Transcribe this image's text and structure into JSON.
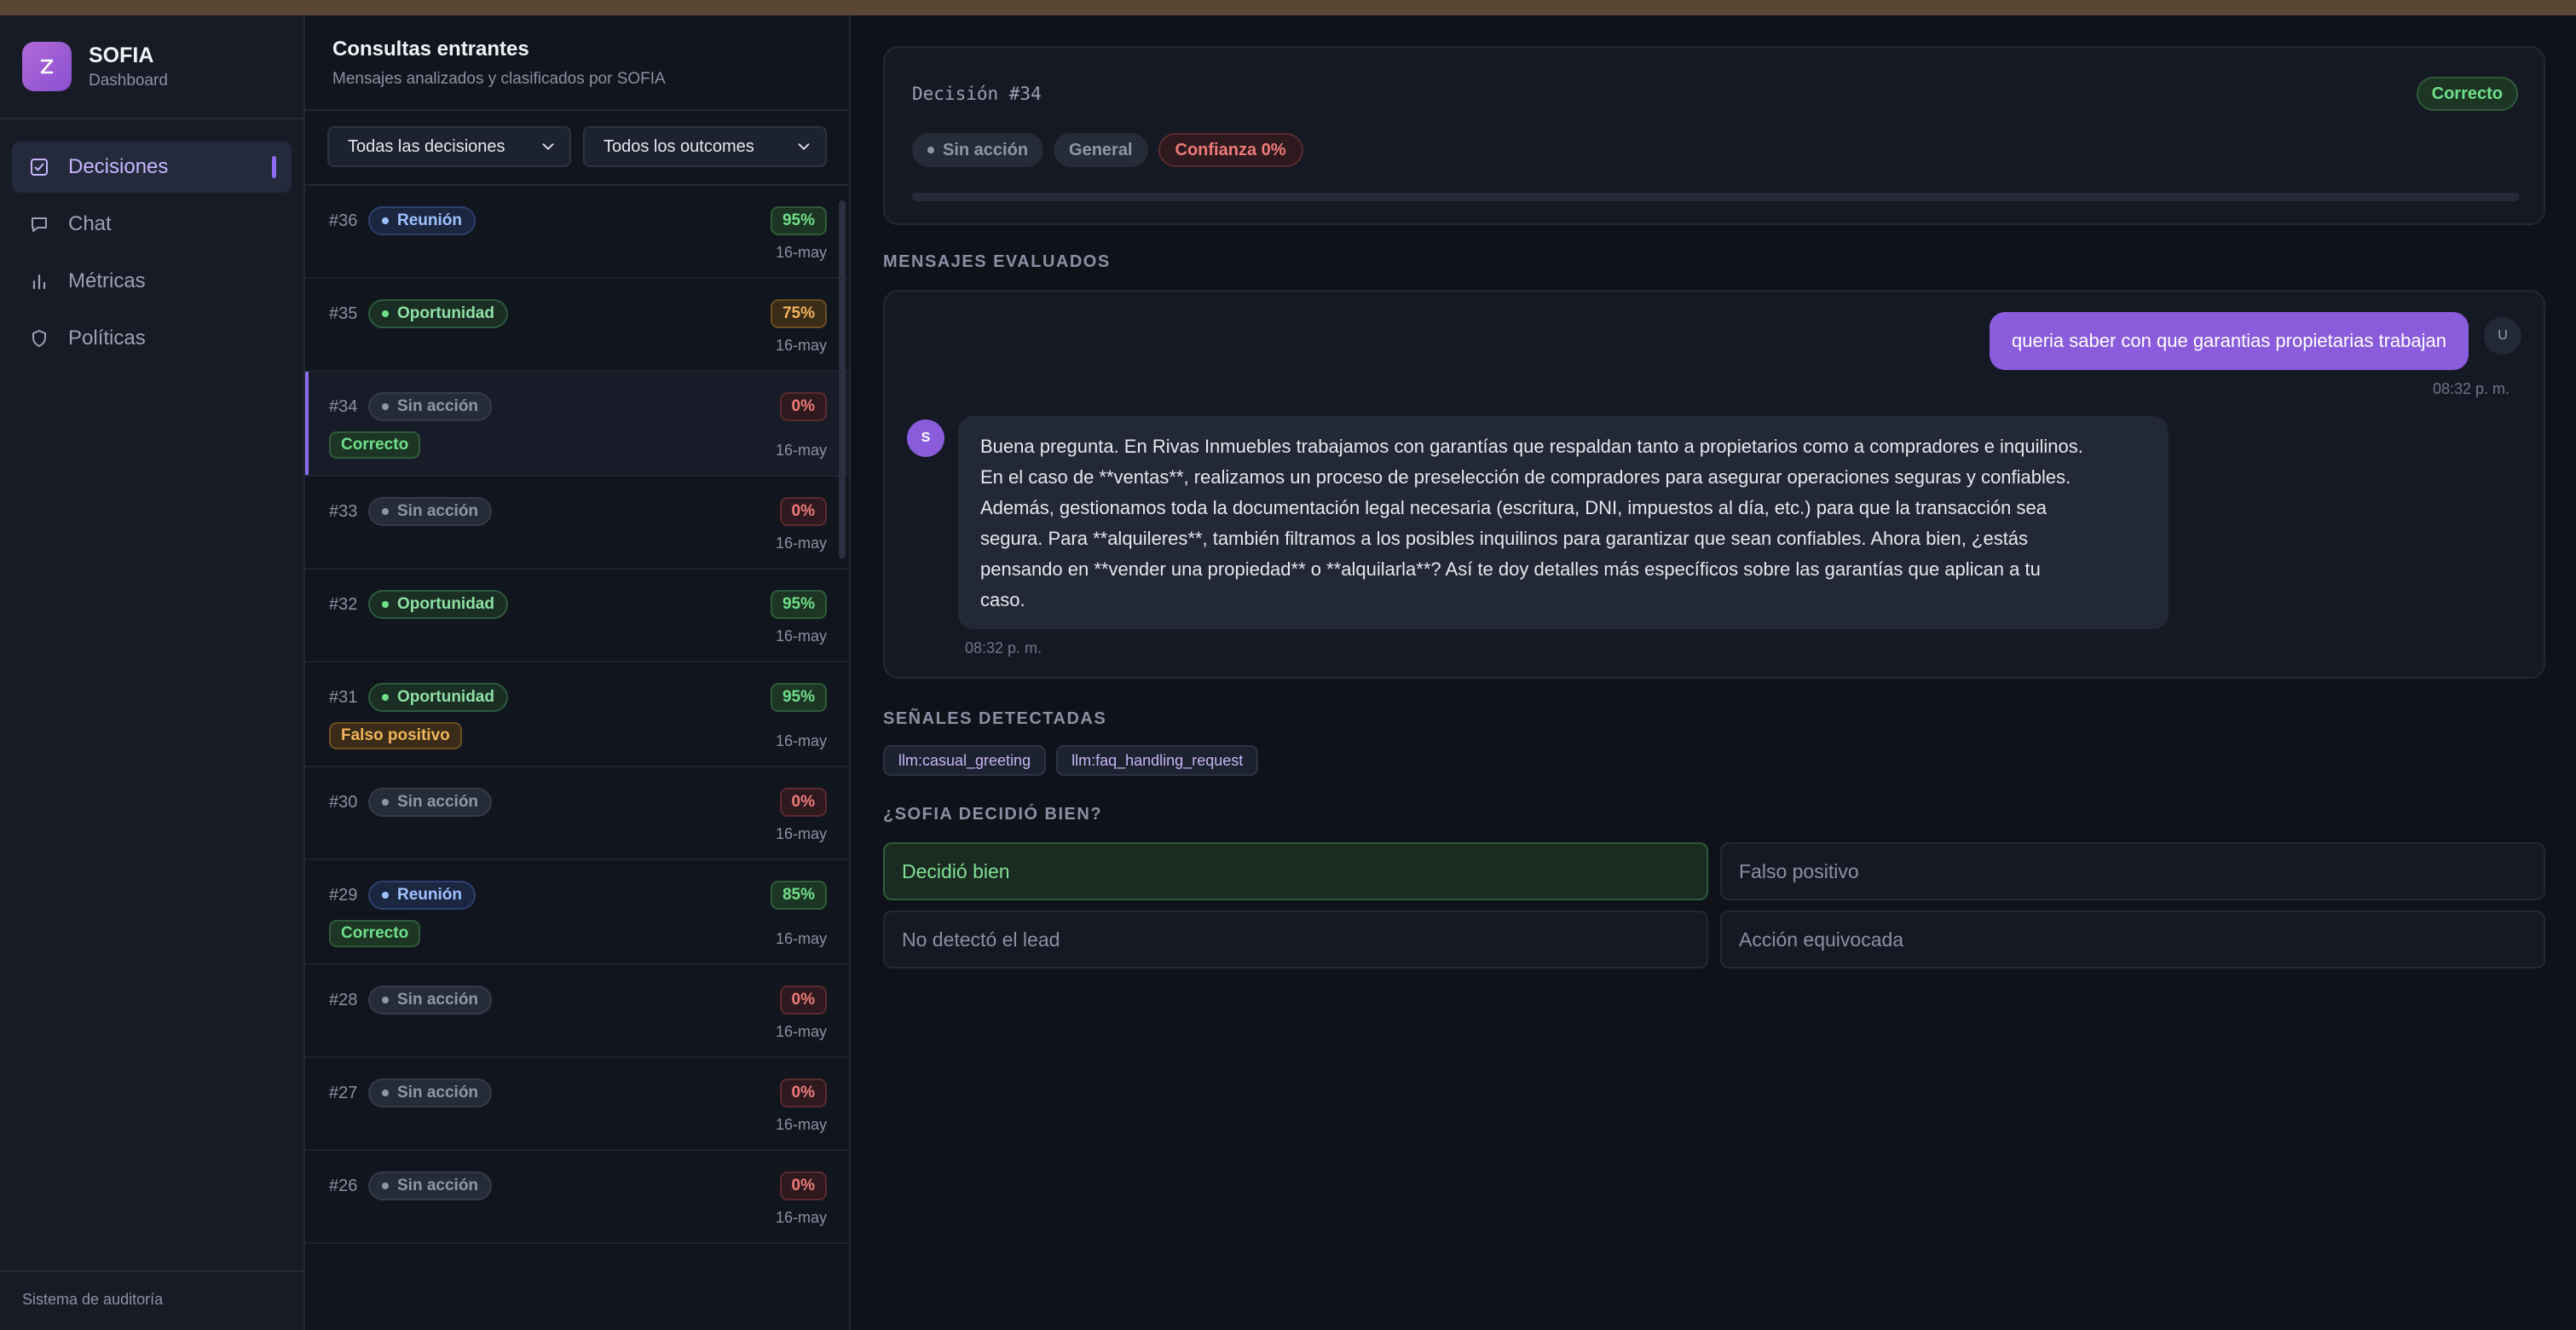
{
  "brand": {
    "name": "SOFIA",
    "subtitle": "Dashboard"
  },
  "nav": [
    {
      "label": "Decisiones",
      "icon": "check-square-icon",
      "active": true
    },
    {
      "label": "Chat",
      "icon": "chat-bubble-icon"
    },
    {
      "label": "Métricas",
      "icon": "bar-chart-icon"
    },
    {
      "label": "Políticas",
      "icon": "shield-icon"
    }
  ],
  "sidebar_footer": "Sistema de auditoría",
  "list": {
    "title": "Consultas entrantes",
    "subtitle": "Mensajes analizados y clasificados por SOFIA",
    "filters": {
      "decision": "Todas las decisiones",
      "outcome": "Todos los outcomes"
    },
    "rows": [
      {
        "id": "#36",
        "tag": "Reunión",
        "pct": "95%",
        "date": "16-may",
        "outcome": ""
      },
      {
        "id": "#35",
        "tag": "Oportunidad",
        "pct": "75%",
        "date": "16-may",
        "outcome": ""
      },
      {
        "id": "#34",
        "tag": "Sin acción",
        "pct": "0%",
        "date": "16-may",
        "outcome": "Correcto"
      },
      {
        "id": "#33",
        "tag": "Sin acción",
        "pct": "0%",
        "date": "16-may",
        "outcome": ""
      },
      {
        "id": "#32",
        "tag": "Oportunidad",
        "pct": "95%",
        "date": "16-may",
        "outcome": ""
      },
      {
        "id": "#31",
        "tag": "Oportunidad",
        "pct": "95%",
        "date": "16-may",
        "outcome": "Falso positivo"
      },
      {
        "id": "#30",
        "tag": "Sin acción",
        "pct": "0%",
        "date": "16-may",
        "outcome": ""
      },
      {
        "id": "#29",
        "tag": "Reunión",
        "pct": "85%",
        "date": "16-may",
        "outcome": "Correcto"
      },
      {
        "id": "#28",
        "tag": "Sin acción",
        "pct": "0%",
        "date": "16-may",
        "outcome": ""
      },
      {
        "id": "#27",
        "tag": "Sin acción",
        "pct": "0%",
        "date": "16-may",
        "outcome": ""
      },
      {
        "id": "#26",
        "tag": "Sin acción",
        "pct": "0%",
        "date": "16-may",
        "outcome": ""
      }
    ]
  },
  "decision": {
    "title": "Decisión #34",
    "status": "Correcto",
    "tags": {
      "action": "Sin acción",
      "category": "General",
      "confidence": "Confianza 0%"
    },
    "confidence_value": 0
  },
  "messages": {
    "section_title": "MENSAJES EVALUADOS",
    "user": {
      "text": "queria saber con que garantias propietarias trabajan",
      "time": "08:32 p. m.",
      "avatar": "U"
    },
    "bot": {
      "avatar": "S",
      "lines": [
        "Buena pregunta. En Rivas Inmuebles trabajamos con garantías que respaldan tanto a propietarios como a compradores e inquilinos.",
        "En el caso de **ventas**, realizamos un proceso de preselección de compradores para asegurar operaciones seguras y confiables.",
        "Además, gestionamos toda la documentación legal necesaria (escritura, DNI, impuestos al día, etc.) para que la transacción sea",
        "segura. Para **alquileres**, también filtramos a los posibles inquilinos para garantizar que sean confiables. Ahora bien, ¿estás",
        "pensando en **vender una propiedad** o **alquilarla**? Así te doy detalles más específicos sobre las garantías que aplican a tu",
        "caso."
      ],
      "time": "08:32 p. m."
    }
  },
  "signals": {
    "section_title": "SEÑALES DETECTADAS",
    "items": [
      "llm:casual_greeting",
      "llm:faq_handling_request"
    ]
  },
  "feedback": {
    "section_title": "¿SOFIA DECIDIÓ BIEN?",
    "options": [
      "Decidió bien",
      "Falso positivo",
      "No detectó el lead",
      "Acción equivocada"
    ],
    "selected": "Decidió bien"
  },
  "colors": {
    "accent": "#8b6cf0",
    "green": "#6fe08a",
    "amber": "#f2b45a",
    "red": "#f07a7a"
  }
}
